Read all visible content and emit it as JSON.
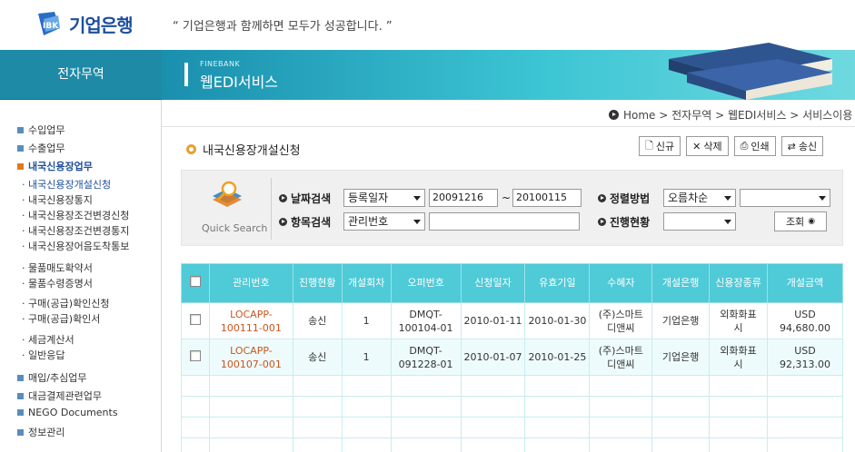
{
  "brand": {
    "name": "기업은행",
    "slogan": "“ 기업은행과 함께하면 모두가 성공합니다. ”"
  },
  "sidebar": {
    "title": "전자무역",
    "items": [
      {
        "label": "수입업무",
        "type": "category"
      },
      {
        "label": "수출업무",
        "type": "category"
      },
      {
        "label": "내국신용장업무",
        "type": "category",
        "active": true
      },
      {
        "label": "내국신용장개설신청",
        "type": "sub",
        "current": true
      },
      {
        "label": "내국신용장통지",
        "type": "sub"
      },
      {
        "label": "내국신용장조건변경신청",
        "type": "sub"
      },
      {
        "label": "내국신용장조건변경통지",
        "type": "sub"
      },
      {
        "label": "내국신용장어음도착통보",
        "type": "sub"
      },
      {
        "label": "물품매도확약서",
        "type": "sub"
      },
      {
        "label": "물품수령증명서",
        "type": "sub"
      },
      {
        "label": "구매(공급)확인신청",
        "type": "sub"
      },
      {
        "label": "구매(공급)확인서",
        "type": "sub"
      },
      {
        "label": "세금계산서",
        "type": "sub"
      },
      {
        "label": "일반응답",
        "type": "sub"
      },
      {
        "label": "매입/추심업무",
        "type": "category"
      },
      {
        "label": "대금결제관련업무",
        "type": "category"
      },
      {
        "label": "NEGO Documents",
        "type": "category"
      },
      {
        "label": "정보관리",
        "type": "category"
      }
    ]
  },
  "banner": {
    "small": "FINEBANK",
    "title": "웹EDI서비스"
  },
  "breadcrumb": "Home > 전자무역 > 웹EDI서비스 > 서비스이용",
  "page": {
    "title": "내국신용장개설신청"
  },
  "toolbar": {
    "new": "신규",
    "delete": "삭제",
    "print": "인쇄",
    "send": "송신"
  },
  "search": {
    "quick_label": "Quick Search",
    "date_label": "날짜검색",
    "date_type": "등록일자",
    "date_from": "20091216",
    "date_sep": "~",
    "date_to": "20100115",
    "sort_label": "정렬방법",
    "sort_value": "오름차순",
    "sort_extra": "",
    "item_label": "항목검색",
    "item_type": "관리번호",
    "item_value": "",
    "status_label": "진행현황",
    "status_value": "",
    "button": "조회"
  },
  "table": {
    "headers": [
      "관리번호",
      "진행현황",
      "개설회차",
      "오퍼번호",
      "신청일자",
      "유효기일",
      "수혜자",
      "개설은행",
      "신용장종류",
      "개설금액"
    ],
    "rows": [
      {
        "id": [
          "LOCAPP-",
          "100111-001"
        ],
        "status": "송신",
        "round": "1",
        "offer": [
          "DMQT-",
          "100104-01"
        ],
        "applied": "2010-01-11",
        "expiry": "2010-01-30",
        "beneficiary": [
          "(주)스마트",
          "디앤씨"
        ],
        "bank": "기업은행",
        "kind": [
          "외화화표",
          "시"
        ],
        "amount": [
          "USD",
          "94,680.00"
        ]
      },
      {
        "id": [
          "LOCAPP-",
          "100107-001"
        ],
        "status": "송신",
        "round": "1",
        "offer": [
          "DMQT-",
          "091228-01"
        ],
        "applied": "2010-01-07",
        "expiry": "2010-01-25",
        "beneficiary": [
          "(주)스마트",
          "디앤씨"
        ],
        "bank": "기업은행",
        "kind": [
          "외화화표",
          "시"
        ],
        "amount": [
          "USD",
          "92,313.00"
        ]
      }
    ]
  },
  "colors": {
    "teal": "#4fcad7",
    "brand_blue": "#1d4f9c",
    "link_orange": "#c8561e"
  }
}
